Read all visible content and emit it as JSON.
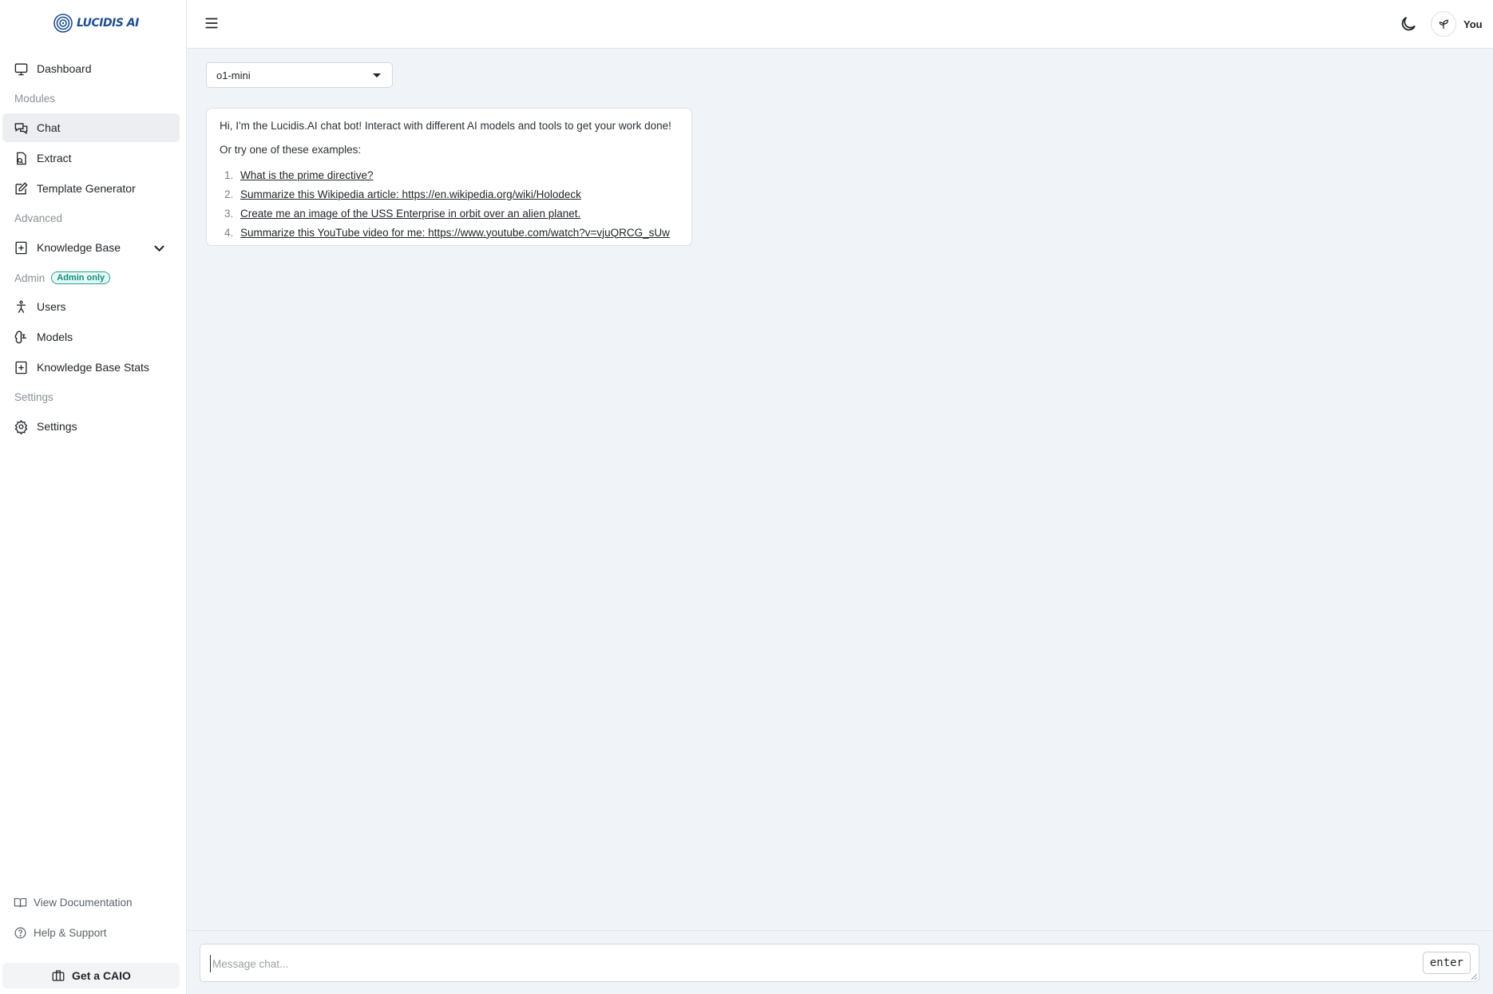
{
  "brand": {
    "logo_text": "LUCIDIS AI"
  },
  "sidebar": {
    "items": [
      {
        "id": "dashboard",
        "label": "Dashboard"
      },
      {
        "id": "chat",
        "label": "Chat",
        "active": true
      },
      {
        "id": "extract",
        "label": "Extract"
      },
      {
        "id": "template-generator",
        "label": "Template Generator"
      },
      {
        "id": "knowledge-base",
        "label": "Knowledge Base"
      },
      {
        "id": "users",
        "label": "Users"
      },
      {
        "id": "models",
        "label": "Models"
      },
      {
        "id": "knowledge-base-stats",
        "label": "Knowledge Base Stats"
      },
      {
        "id": "settings",
        "label": "Settings"
      }
    ],
    "sections": {
      "modules": "Modules",
      "advanced": "Advanced",
      "admin": "Admin",
      "admin_badge": "Admin only",
      "settings": "Settings"
    },
    "footer": {
      "docs": "View Documentation",
      "help": "Help & Support",
      "cta": "Get a CAIO"
    }
  },
  "header": {
    "user_name": "You"
  },
  "model_select": {
    "value": "o1-mini"
  },
  "chat": {
    "intro": "Hi, I'm the Lucidis.AI chat bot! Interact with different AI models and tools to get your work done!",
    "try_text": "Or try one of these examples:",
    "examples": [
      {
        "num": "1.",
        "text": "What is the prime directive?"
      },
      {
        "num": "2.",
        "text": "Summarize this Wikipedia article: https://en.wikipedia.org/wiki/Holodeck"
      },
      {
        "num": "3.",
        "text": "Create me an image of the USS Enterprise in orbit over an alien planet."
      },
      {
        "num": "4.",
        "text": "Summarize this YouTube video for me: https://www.youtube.com/watch?v=vjuQRCG_sUw"
      }
    ]
  },
  "composer": {
    "placeholder": "Message chat...",
    "enter_label": "enter"
  },
  "colors": {
    "accent": "#1d4f91",
    "badge": "#0f8f7f",
    "background": "#f0f4f8"
  }
}
